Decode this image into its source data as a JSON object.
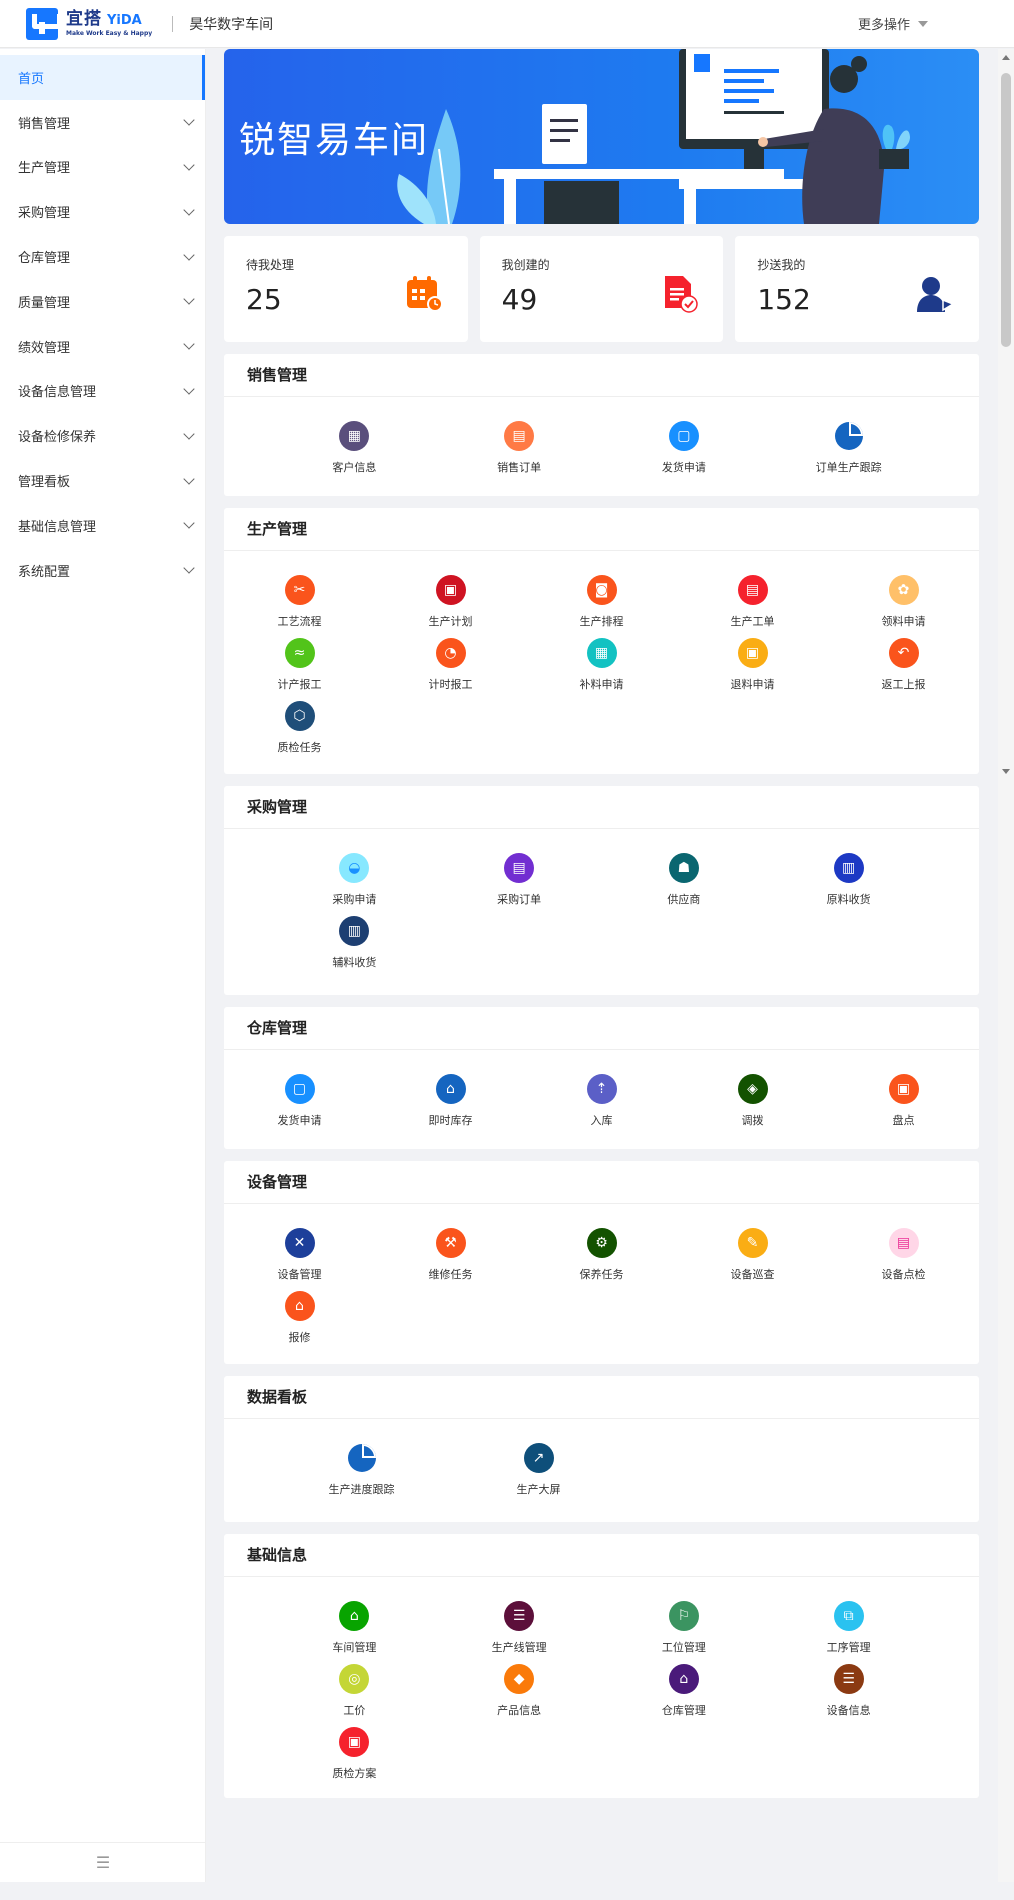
{
  "header": {
    "brand": "宜搭",
    "brand_en": "YiDA",
    "slogan": "Make Work Easy & Happy",
    "app_name": "昊华数字车间",
    "more_ops": "更多操作"
  },
  "sidebar": {
    "items": [
      {
        "label": "首页"
      },
      {
        "label": "销售管理"
      },
      {
        "label": "生产管理"
      },
      {
        "label": "采购管理"
      },
      {
        "label": "仓库管理"
      },
      {
        "label": "质量管理"
      },
      {
        "label": "绩效管理"
      },
      {
        "label": "设备信息管理"
      },
      {
        "label": "设备检修保养"
      },
      {
        "label": "管理看板"
      },
      {
        "label": "基础信息管理"
      },
      {
        "label": "系统配置"
      }
    ],
    "collapse_icon": "☰"
  },
  "banner": {
    "title": "锐智易车间"
  },
  "stats": [
    {
      "label": "待我处理",
      "value": "25"
    },
    {
      "label": "我创建的",
      "value": "49"
    },
    {
      "label": "抄送我的",
      "value": "152"
    }
  ],
  "sections": {
    "sales": {
      "title": "销售管理",
      "items": [
        "客户信息",
        "销售订单",
        "发货申请",
        "订单生产跟踪"
      ]
    },
    "production": {
      "title": "生产管理",
      "items": [
        "工艺流程",
        "生产计划",
        "生产排程",
        "生产工单",
        "领料申请",
        "计产报工",
        "计时报工",
        "补料申请",
        "退料申请",
        "返工上报",
        "质检任务"
      ]
    },
    "purchase": {
      "title": "采购管理",
      "items": [
        "采购申请",
        "采购订单",
        "供应商",
        "原料收货",
        "辅料收货"
      ]
    },
    "warehouse": {
      "title": "仓库管理",
      "items": [
        "发货申请",
        "即时库存",
        "入库",
        "调拨",
        "盘点"
      ]
    },
    "equipment": {
      "title": "设备管理",
      "items": [
        "设备管理",
        "维修任务",
        "保养任务",
        "设备巡查",
        "设备点检",
        "报修"
      ]
    },
    "dashboard": {
      "title": "数据看板",
      "items": [
        "生产进度跟踪",
        "生产大屏"
      ]
    },
    "basic": {
      "title": "基础信息",
      "items": [
        "车间管理",
        "生产线管理",
        "工位管理",
        "工序管理",
        "工价",
        "产品信息",
        "仓库管理",
        "设备信息",
        "质检方案"
      ]
    }
  },
  "colors": {
    "accent": "#1677ff",
    "banner": "#2563eb"
  }
}
